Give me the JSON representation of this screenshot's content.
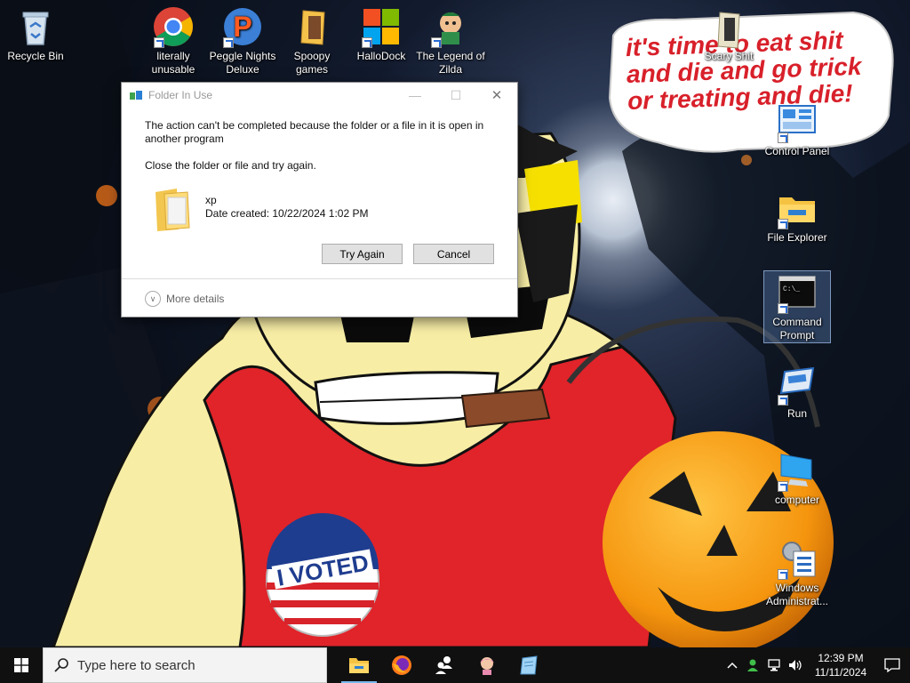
{
  "wallpaper": {
    "speech_text": "it's time to eat shit and die and go trick or treating and die!",
    "badge_text": "I VOTED"
  },
  "desktop_icons": [
    {
      "id": "recycle-bin",
      "label": "Recycle Bin",
      "icon": "recycle-bin-icon"
    },
    {
      "id": "chrome",
      "label": "literally unusable",
      "icon": "chrome-icon"
    },
    {
      "id": "peggle",
      "label": "Peggle Nights Deluxe",
      "icon": "peggle-icon"
    },
    {
      "id": "spoopy",
      "label": "Spoopy games",
      "icon": "folder-icon"
    },
    {
      "id": "hallodock",
      "label": "HalloDock",
      "icon": "windows-logo-icon"
    },
    {
      "id": "zilda",
      "label": "The Legend of Zilda",
      "icon": "zilda-icon"
    },
    {
      "id": "scary",
      "label": "Scary Shit",
      "icon": "folder-icon"
    },
    {
      "id": "control-panel",
      "label": "Control Panel",
      "icon": "control-panel-icon"
    },
    {
      "id": "file-explorer",
      "label": "File Explorer",
      "icon": "file-explorer-icon"
    },
    {
      "id": "cmd",
      "label": "Command Prompt",
      "icon": "command-prompt-icon"
    },
    {
      "id": "run",
      "label": "Run",
      "icon": "run-icon"
    },
    {
      "id": "computer",
      "label": "computer",
      "icon": "computer-icon"
    },
    {
      "id": "admin-tools",
      "label": "Windows Administrat...",
      "icon": "admin-tools-icon"
    }
  ],
  "dialog": {
    "title": "Folder In Use",
    "message": "The action can't be completed because the folder or a file in it is open in another program",
    "instruction": "Close the folder or file and try again.",
    "file_name": "xp",
    "file_date": "Date created: 10/22/2024 1:02 PM",
    "try_again": "Try Again",
    "cancel": "Cancel",
    "more_details": "More details",
    "minimize": "—",
    "maximize": "☐",
    "close": "✕"
  },
  "taskbar": {
    "search_placeholder": "Type here to search",
    "apps": [
      "file-explorer-icon",
      "firefox-icon",
      "people-icon",
      "anime-girl-icon",
      "notepad-icon"
    ],
    "time": "12:39 PM",
    "date": "11/11/2024"
  },
  "colors": {
    "taskbar": "#101010",
    "dialog_button": "#e1e1e1",
    "shirt_red": "#e0242a",
    "skin": "#f7eda5",
    "pumpkin": "#f59a12"
  }
}
